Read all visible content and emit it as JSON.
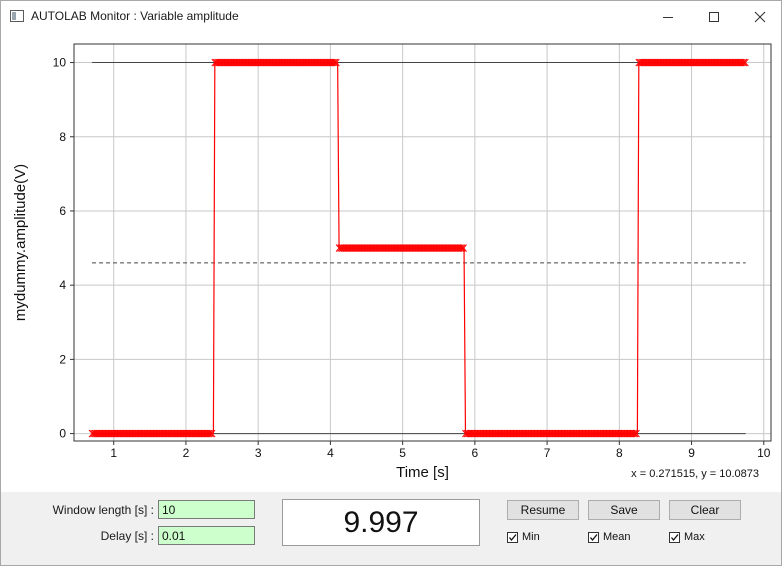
{
  "window": {
    "title": "AUTOLAB Monitor : Variable amplitude"
  },
  "chart_data": {
    "type": "line",
    "xlabel": "Time [s]",
    "ylabel": "mydummy.amplitude(V)",
    "xlim": [
      0.45,
      10.1
    ],
    "ylim": [
      -0.2,
      10.5
    ],
    "x_ticks": [
      1,
      2,
      3,
      4,
      5,
      6,
      7,
      8,
      9,
      10
    ],
    "y_ticks": [
      0,
      2,
      4,
      6,
      8,
      10
    ],
    "grid": true,
    "series": [
      {
        "color": "#ff0000",
        "marker": "x",
        "x": [
          0.7,
          2.38,
          2.4,
          4.1,
          4.12,
          5.85,
          5.87,
          8.25,
          8.27,
          9.75
        ],
        "y": [
          0,
          0,
          10,
          10,
          5,
          5,
          0,
          0,
          10,
          10
        ]
      }
    ],
    "reference_lines": [
      {
        "name": "Max",
        "y": 10.0,
        "style": "solid"
      },
      {
        "name": "Mean",
        "y": 4.6,
        "style": "dashed"
      },
      {
        "name": "Min",
        "y": 0.0,
        "style": "solid"
      }
    ]
  },
  "coord_readout": "x = 0.271515, y = 10.0873",
  "controls": {
    "window_length_label": "Window length [s] :",
    "window_length_value": "10",
    "delay_label": "Delay [s] :",
    "delay_value": "0.01",
    "current_value": "9.997",
    "resume_label": "Resume",
    "save_label": "Save",
    "clear_label": "Clear",
    "min_label": "Min",
    "mean_label": "Mean",
    "max_label": "Max",
    "min_checked": true,
    "mean_checked": true,
    "max_checked": true
  }
}
